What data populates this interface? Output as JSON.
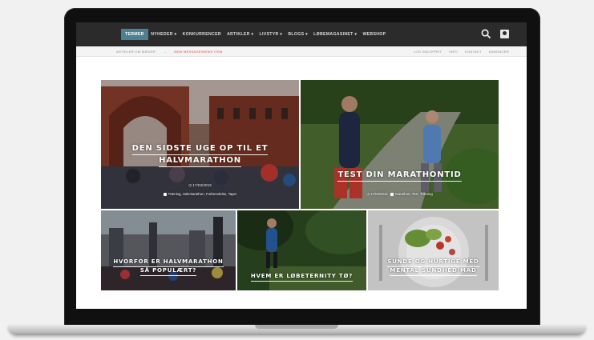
{
  "nav": {
    "items": [
      {
        "label": "TERMER",
        "active": true
      },
      {
        "label": "NYHEDER ▾"
      },
      {
        "label": "KONKURRENCER"
      },
      {
        "label": "ARTIKLER ▾"
      },
      {
        "label": "LIVSTYR ▾"
      },
      {
        "label": "BLOGS ▾"
      },
      {
        "label": "LØBEMAGASINET ▾"
      },
      {
        "label": "WEBSHOP"
      }
    ],
    "search_icon": "search-icon",
    "user_icon": "user-icon"
  },
  "subbar": {
    "left_text": "ARTIKLER OM MÆDER",
    "arrow": "→",
    "news_text": "NEW MESSAGE/NEWS ITEM",
    "right_links": [
      "LOG IND/OPRET",
      "INFO",
      "KONTAKT",
      "ANNONCER"
    ]
  },
  "tiles": {
    "featured_left": {
      "title_line1": "DEN SIDSTE UGE OP TIL ET",
      "title_line2": "HALVMARATHON",
      "date": "17/03/2015",
      "tags": "Træning, Halvmarathon, Forberedelse, Taper"
    },
    "featured_right": {
      "title": "TEST DIN MARATHONTID",
      "date": "17/03/2015",
      "tags": "Marathon, Test, Træning"
    },
    "small_1": {
      "title_line1": "HVORFOR ER HALVMARATHON",
      "title_line2": "SÅ POPULÆRT?"
    },
    "small_2": {
      "title": "HVEM ER LØBETERNITY TØ?"
    },
    "small_3": {
      "title_line1": "SUNDE OG HURTIGE MED",
      "title_line2": "MENTAL SUNDHED/MAD"
    }
  },
  "colors": {
    "nav_bg": "#2b2b2b",
    "nav_active": "#4d7f92",
    "news_red": "#d14b3d"
  }
}
